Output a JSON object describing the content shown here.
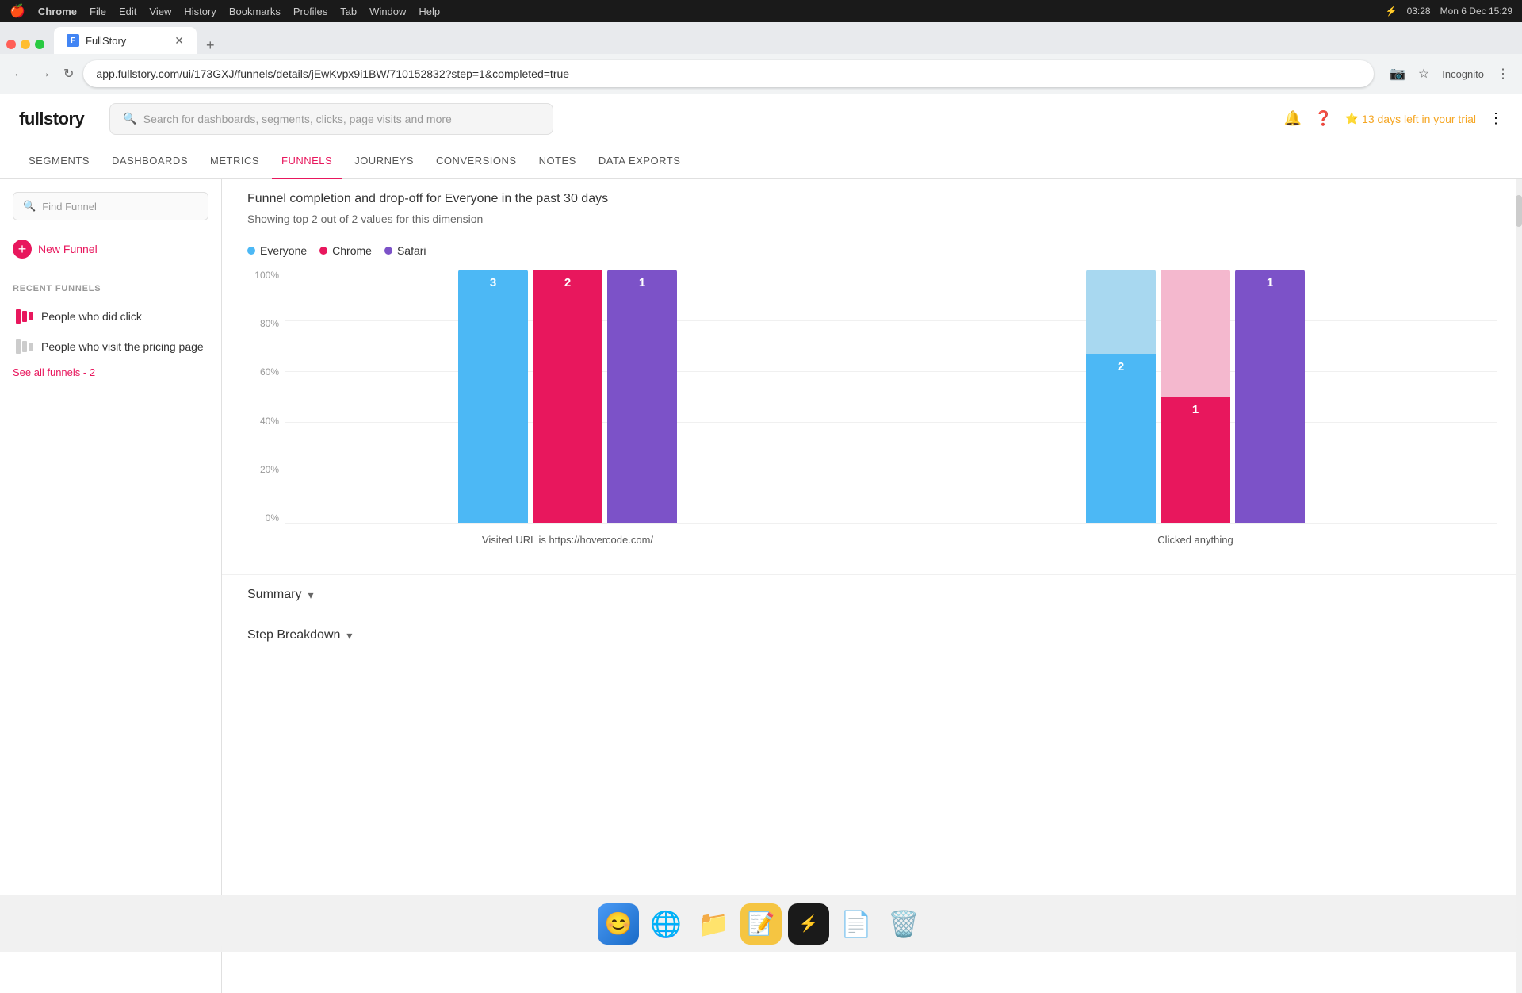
{
  "macos": {
    "apple": "🍎",
    "app_name": "Chrome",
    "menu_items": [
      "File",
      "Edit",
      "View",
      "History",
      "Bookmarks",
      "Profiles",
      "Tab",
      "Window",
      "Help"
    ],
    "time": "Mon 6 Dec  15:29",
    "battery_icon": "⚡",
    "battery_time": "03:28"
  },
  "browser": {
    "tab_title": "FullStory",
    "url": "app.fullstory.com/ui/173GXJ/funnels/details/jEwKvpx9i1BW/710152832?step=1&completed=true",
    "profile": "Incognito"
  },
  "header": {
    "logo": "fullstory",
    "search_placeholder": "Search for dashboards, segments, clicks, page visits and more",
    "trial_text": "13 days left in your trial"
  },
  "nav": {
    "items": [
      {
        "label": "SEGMENTS",
        "active": false
      },
      {
        "label": "DASHBOARDS",
        "active": false
      },
      {
        "label": "METRICS",
        "active": false
      },
      {
        "label": "FUNNELS",
        "active": true
      },
      {
        "label": "JOURNEYS",
        "active": false
      },
      {
        "label": "CONVERSIONS",
        "active": false
      },
      {
        "label": "NOTES",
        "active": false
      },
      {
        "label": "DATA EXPORTS",
        "active": false
      }
    ]
  },
  "sidebar": {
    "find_placeholder": "Find Funnel",
    "new_funnel_label": "New Funnel",
    "recent_label": "RECENT FUNNELS",
    "funnels": [
      {
        "name": "People who did click",
        "active": true
      },
      {
        "name": "People who visit the pricing page",
        "active": false
      }
    ],
    "see_all": "See all funnels - 2"
  },
  "content": {
    "subtitle": "Funnel completion and drop-off for Everyone in the past 30 days",
    "showing_text": "Showing top 2 out of 2 values for this dimension",
    "legend": [
      {
        "label": "Everyone",
        "color": "#4cb8f5"
      },
      {
        "label": "Chrome",
        "color": "#e8175d"
      },
      {
        "label": "Safari",
        "color": "#7c52c8"
      }
    ],
    "y_axis": [
      "100%",
      "80%",
      "60%",
      "40%",
      "20%",
      "0%"
    ],
    "bars_step1": [
      {
        "color": "#4cb8f5",
        "height_pct": 100,
        "label": "3",
        "label_color": "white"
      },
      {
        "color": "#e8175d",
        "height_pct": 100,
        "label": "2",
        "label_color": "white"
      },
      {
        "color": "#7c52c8",
        "height_pct": 100,
        "label": "1",
        "label_color": "white"
      }
    ],
    "bars_step2": [
      {
        "color": "#b8e0f8",
        "height_pct": 30,
        "label": "",
        "sublabel": ""
      },
      {
        "color": "#4cb8f5",
        "height_pct": 67,
        "label": "2",
        "label_color": "white"
      },
      {
        "color": "#f4a0c0",
        "height_pct": 30,
        "label": "",
        "sublabel": ""
      },
      {
        "color": "#e8175d",
        "height_pct": 50,
        "label": "1",
        "label_color": "white"
      },
      {
        "color": "#7c52c8",
        "height_pct": 100,
        "label": "1",
        "label_color": "white"
      }
    ],
    "x_labels": [
      "Visited URL is https://hovercode.com/",
      "Clicked anything"
    ],
    "summary_title": "Summary",
    "step_breakdown_title": "Step Breakdown"
  },
  "dock": {
    "items": [
      {
        "icon": "🍎",
        "name": "finder"
      },
      {
        "icon": "🌐",
        "name": "chrome"
      },
      {
        "icon": "📁",
        "name": "files"
      },
      {
        "icon": "⚡",
        "name": "reeder"
      },
      {
        "icon": "📝",
        "name": "notes"
      },
      {
        "icon": "🗑️",
        "name": "trash"
      }
    ]
  }
}
